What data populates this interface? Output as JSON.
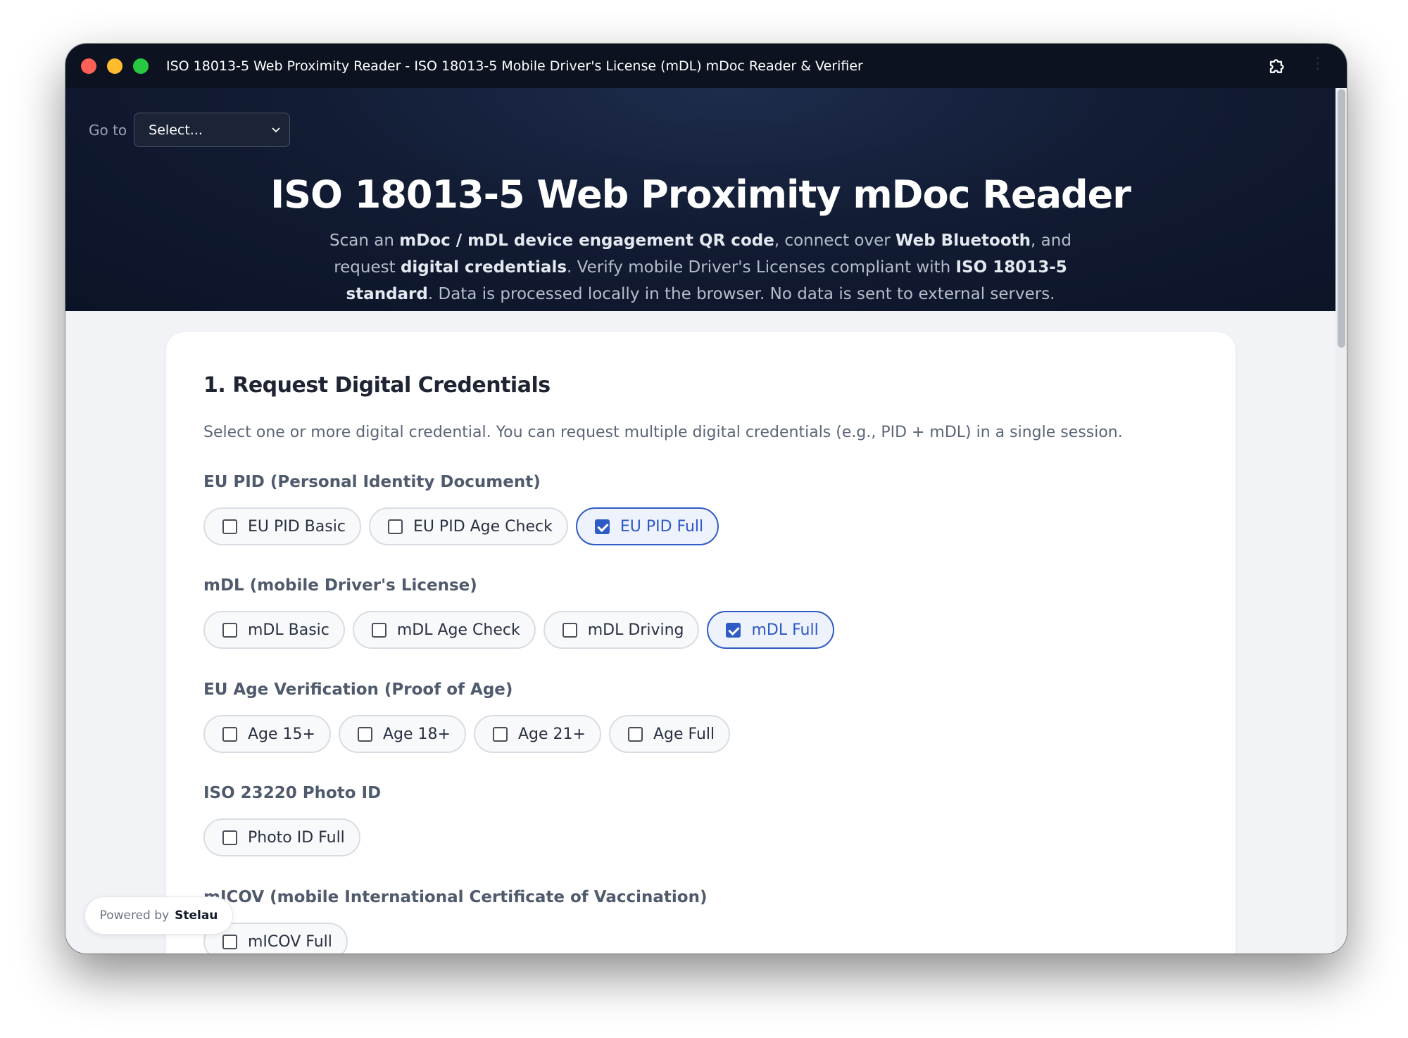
{
  "window": {
    "title": "ISO 18013-5 Web Proximity Reader - ISO 18013-5 Mobile Driver's License (mDL) mDoc Reader & Verifier"
  },
  "nav": {
    "goto_label": "Go to",
    "select_value": "Select..."
  },
  "hero": {
    "title": "ISO 18013-5 Web Proximity mDoc Reader",
    "desc_parts": [
      "Scan an ",
      "mDoc / mDL device engagement QR code",
      ", connect over ",
      "Web Bluetooth",
      ", and request ",
      "digital credentials",
      ". Verify mobile Driver's Licenses compliant with ",
      "ISO 18013-5 standard",
      ". Data is processed locally in the browser. No data is sent to external servers."
    ]
  },
  "section": {
    "title": "1. Request Digital Credentials",
    "description": "Select one or more digital credential. You can request multiple digital credentials (e.g., PID + mDL) in a single session.",
    "groups": [
      {
        "label": "EU PID (Personal Identity Document)",
        "options": [
          {
            "label": "EU PID Basic",
            "checked": false
          },
          {
            "label": "EU PID Age Check",
            "checked": false
          },
          {
            "label": "EU PID Full",
            "checked": true
          }
        ]
      },
      {
        "label": "mDL (mobile Driver's License)",
        "options": [
          {
            "label": "mDL Basic",
            "checked": false
          },
          {
            "label": "mDL Age Check",
            "checked": false
          },
          {
            "label": "mDL Driving",
            "checked": false
          },
          {
            "label": "mDL Full",
            "checked": true
          }
        ]
      },
      {
        "label": "EU Age Verification (Proof of Age)",
        "options": [
          {
            "label": "Age 15+",
            "checked": false
          },
          {
            "label": "Age 18+",
            "checked": false
          },
          {
            "label": "Age 21+",
            "checked": false
          },
          {
            "label": "Age Full",
            "checked": false
          }
        ]
      },
      {
        "label": "ISO 23220 Photo ID",
        "options": [
          {
            "label": "Photo ID Full",
            "checked": false
          }
        ]
      },
      {
        "label": "mICOV (mobile International Certificate of Vaccination)",
        "options": [
          {
            "label": "mICOV Full",
            "checked": false
          }
        ]
      }
    ]
  },
  "badge": {
    "prefix": "Powered by",
    "brand": "Stelau"
  },
  "colors": {
    "accent": "#2f5bc4",
    "hero_bg": "#121c34"
  },
  "icons": {
    "extension": "puzzle-icon",
    "menu": "more-vertical-icon",
    "select": "chevron-down-icon"
  }
}
